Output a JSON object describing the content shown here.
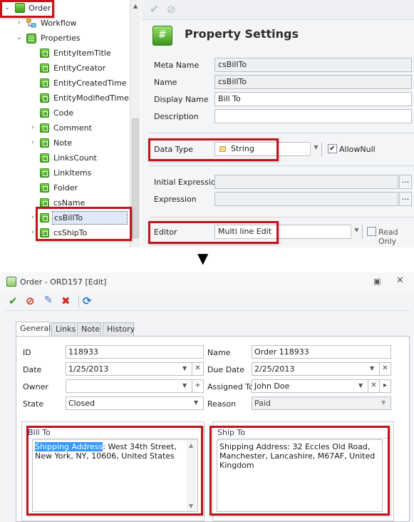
{
  "tree": {
    "root": "Order",
    "items": [
      {
        "label": "Workflow",
        "expandable": true
      },
      {
        "label": "Properties",
        "expanded": true
      },
      {
        "label": "EntityItemTitle"
      },
      {
        "label": "EntityCreator"
      },
      {
        "label": "EntityCreatedTime"
      },
      {
        "label": "EntityModifiedTime"
      },
      {
        "label": "Code"
      },
      {
        "label": "Comment",
        "expandable": true
      },
      {
        "label": "Note",
        "expandable": true
      },
      {
        "label": "LinksCount"
      },
      {
        "label": "LinkItems"
      },
      {
        "label": "Folder"
      },
      {
        "label": "csName"
      },
      {
        "label": "csBillTo",
        "expandable": true,
        "selected": true
      },
      {
        "label": "csShipTo",
        "expandable": true
      }
    ]
  },
  "property_settings": {
    "title": "Property Settings",
    "fields": {
      "meta_name": {
        "label": "Meta Name",
        "value": "csBillTo"
      },
      "name": {
        "label": "Name",
        "value": "csBillTo"
      },
      "display_name": {
        "label": "Display Name",
        "value": "Bill To"
      },
      "description": {
        "label": "Description",
        "value": ""
      },
      "data_type": {
        "label": "Data Type",
        "value": "String"
      },
      "allow_null": {
        "label": "AllowNull",
        "checked": true
      },
      "initial_expression": {
        "label": "Initial Expression",
        "value": ""
      },
      "expression": {
        "label": "Expression",
        "value": ""
      },
      "editor": {
        "label": "Editor",
        "value": "Multi line Edit"
      },
      "read_only": {
        "label": "Read Only",
        "checked": false
      }
    },
    "ellipsis": "..."
  },
  "window": {
    "title": "Order - ORD157 [Edit]",
    "tabs": [
      "General",
      "Links",
      "Note",
      "History"
    ],
    "active_tab": "General",
    "form": {
      "id": {
        "label": "ID",
        "value": "118933"
      },
      "name": {
        "label": "Name",
        "value": "Order 118933"
      },
      "date": {
        "label": "Date",
        "value": "1/25/2013"
      },
      "due_date": {
        "label": "Due Date",
        "value": "2/25/2013"
      },
      "owner": {
        "label": "Owner",
        "value": ""
      },
      "assigned_to": {
        "label": "Assigned To",
        "value": "John Doe"
      },
      "state": {
        "label": "State",
        "value": "Closed"
      },
      "reason": {
        "label": "Reason",
        "value": "Paid"
      }
    },
    "bill_to": {
      "label": "Bill To",
      "highlight": "Shipping Address",
      "rest": ": West 34th Street, New York, NY, 10606, United States"
    },
    "ship_to": {
      "label": "Ship To",
      "value": "Shipping Address: 32 Eccles Old Road, Manchester, Lancashire, M67AF, United Kingdom"
    }
  },
  "colors": {
    "highlight_red": "#c0151b",
    "accent_green": "#3f9a1f",
    "selection_blue": "#3399ff"
  }
}
